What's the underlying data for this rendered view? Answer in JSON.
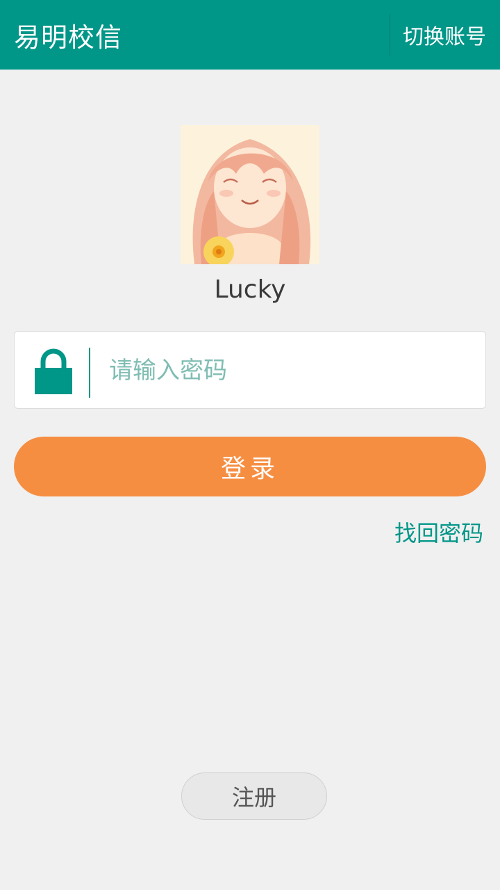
{
  "header": {
    "app_title": "易明校信",
    "switch_account_label": "切换账号"
  },
  "profile": {
    "username": "Lucky",
    "avatar_icon": "avatar-illustration"
  },
  "login_form": {
    "password_placeholder": "请输入密码",
    "password_value": "",
    "lock_icon": "lock-icon",
    "login_label": "登录",
    "forgot_password_label": "找回密码"
  },
  "footer": {
    "register_label": "注册"
  },
  "colors": {
    "primary": "#009688",
    "login_button": "#f68e42",
    "background": "#f0f0f0",
    "placeholder": "#7fbdb3"
  }
}
